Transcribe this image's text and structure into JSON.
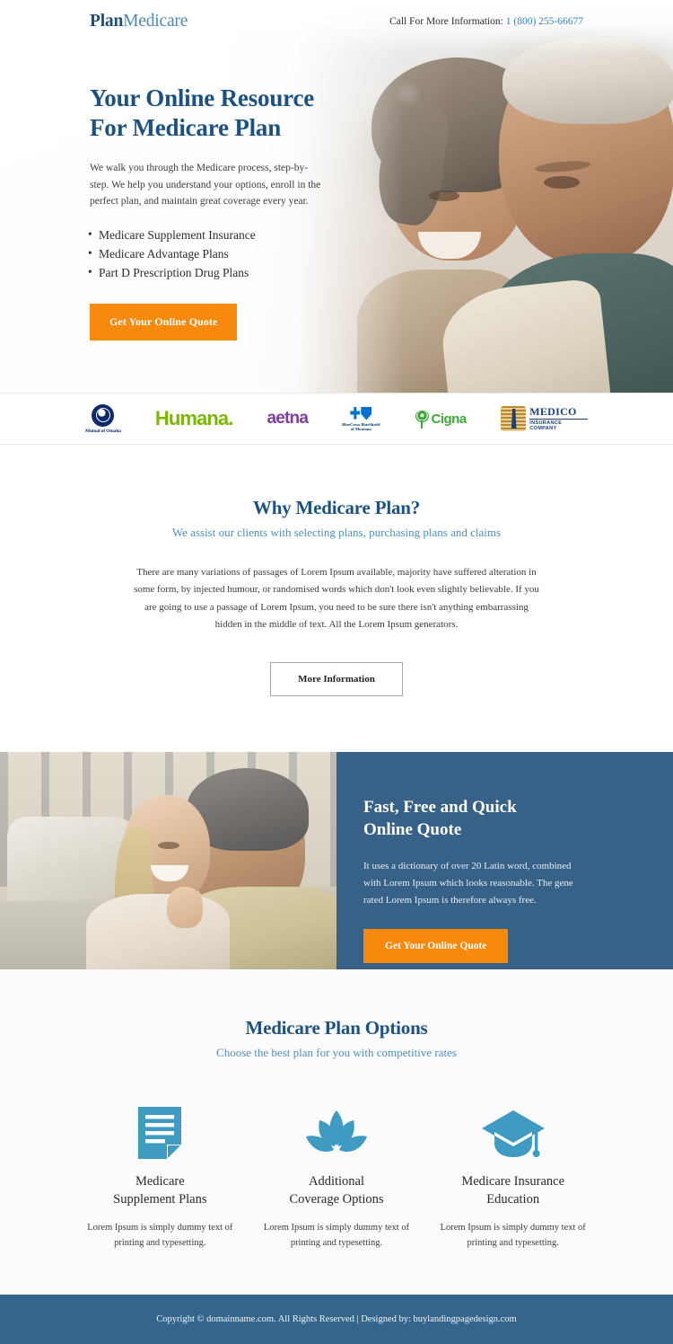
{
  "header": {
    "logo_part1": "Plan",
    "logo_part2": "Medicare",
    "call_label": "Call For More Information:",
    "phone": "1 (800) 255-66677"
  },
  "hero": {
    "heading_line1": "Your Online Resource",
    "heading_line2": "For Medicare Plan",
    "subtext": "We walk you through the Medicare process, step-by-step. We help you understand your options, enroll in the perfect plan, and maintain great coverage every year.",
    "bullets": [
      "Medicare Supplement Insurance",
      "Medicare Advantage Plans",
      "Part D Prescription Drug Plans"
    ],
    "cta_label": "Get Your Online Quote"
  },
  "partners": [
    {
      "name": "Mutual of Omaha",
      "label": "Mutual of Omaha"
    },
    {
      "name": "Humana",
      "label": "Humana."
    },
    {
      "name": "aetna",
      "label": "aetna"
    },
    {
      "name": "BlueCross BlueShield of Montana",
      "line1": "BlueCross BlueShield",
      "line2": "of Montana"
    },
    {
      "name": "Cigna",
      "label": "Cigna"
    },
    {
      "name": "Medico Insurance Company",
      "line1": "MEDICO",
      "line2": "INSURANCE COMPANY"
    }
  ],
  "why": {
    "title": "Why Medicare Plan?",
    "subtitle": "We assist our clients with selecting plans, purchasing plans and claims",
    "body": "There are many variations of passages of Lorem Ipsum available, majority have suffered alteration in some form, by injected humour, or randomised words which don't look even slightly believable. If you are going to use a passage of Lorem Ipsum, you need to be sure there isn't anything embarrassing hidden in the middle of text. All the Lorem Ipsum generators.",
    "button_label": "More Information"
  },
  "quote_section": {
    "heading_line1": "Fast, Free and Quick",
    "heading_line2": "Online Quote",
    "body": "It uses a dictionary of over 20 Latin word, combined with Lorem Ipsum which looks reasonable. The gene rated Lorem Ipsum is therefore always free.",
    "cta_label": "Get Your Online Quote",
    "panel_color": "#376187"
  },
  "options": {
    "title": "Medicare Plan Options",
    "subtitle": "Choose the best plan for you with competitive rates",
    "icon_color": "#3f9bc2",
    "items": [
      {
        "icon": "document-icon",
        "name_line1": "Medicare",
        "name_line2": "Supplement Plans",
        "desc": "Lorem Ipsum is simply dummy text of printing and typesetting."
      },
      {
        "icon": "lotus-icon",
        "name_line1": "Additional",
        "name_line2": "Coverage Options",
        "desc": "Lorem Ipsum is simply dummy text of printing and typesetting."
      },
      {
        "icon": "graduation-cap-icon",
        "name_line1": "Medicare Insurance",
        "name_line2": "Education",
        "desc": "Lorem Ipsum is simply dummy text of printing and typesetting."
      }
    ]
  },
  "footer": {
    "text": "Copyright © domainname.com. All Rights Reserved | Designed by: buylandingpagedesign.com",
    "background": "#34658a"
  },
  "theme": {
    "brand_blue": "#1d5280",
    "accent_orange": "#f7890c",
    "link_blue": "#2e82c0"
  }
}
